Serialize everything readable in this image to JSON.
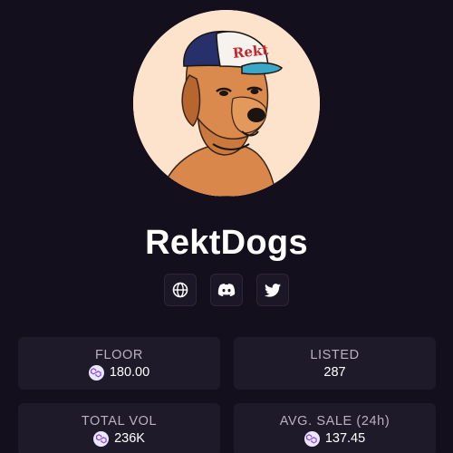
{
  "collection": {
    "name": "RektDogs",
    "avatar_icon": "rektdogs-avatar-icon",
    "hat_text": "Rekt"
  },
  "socials": [
    {
      "name": "website",
      "icon": "globe-icon"
    },
    {
      "name": "discord",
      "icon": "discord-icon"
    },
    {
      "name": "twitter",
      "icon": "twitter-icon"
    }
  ],
  "stats": {
    "floor": {
      "label": "FLOOR",
      "value": "180.00",
      "icon": "polygon-icon"
    },
    "listed": {
      "label": "LISTED",
      "value": "287"
    },
    "total_vol": {
      "label": "TOTAL VOL",
      "value": "236K",
      "icon": "polygon-icon"
    },
    "avg_sale": {
      "label": "AVG. SALE (24h)",
      "value": "137.45",
      "icon": "polygon-icon"
    }
  },
  "colors": {
    "background": "#140f1c",
    "card": "#1f1a2a",
    "avatar_bg": "#fde3cc",
    "text": "#ffffff",
    "muted": "#b7b1c2"
  }
}
